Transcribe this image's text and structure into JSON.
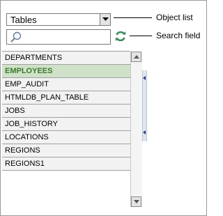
{
  "object_list": {
    "selected": "Tables",
    "callout": "Object list"
  },
  "search": {
    "value": "",
    "placeholder": "",
    "callout": "Search field"
  },
  "list": {
    "items": [
      {
        "label": "DEPARTMENTS"
      },
      {
        "label": "EMPLOYEES"
      },
      {
        "label": "EMP_AUDIT"
      },
      {
        "label": "HTMLDB_PLAN_TABLE"
      },
      {
        "label": "JOBS"
      },
      {
        "label": "JOB_HISTORY"
      },
      {
        "label": "LOCATIONS"
      },
      {
        "label": "REGIONS"
      },
      {
        "label": "REGIONS1"
      }
    ],
    "selected_item": "EMPLOYEES"
  },
  "colors": {
    "selected_bg": "#cfe2c9",
    "selected_text": "#3a7a2a",
    "refresh_icon": "#3f8a5a"
  }
}
